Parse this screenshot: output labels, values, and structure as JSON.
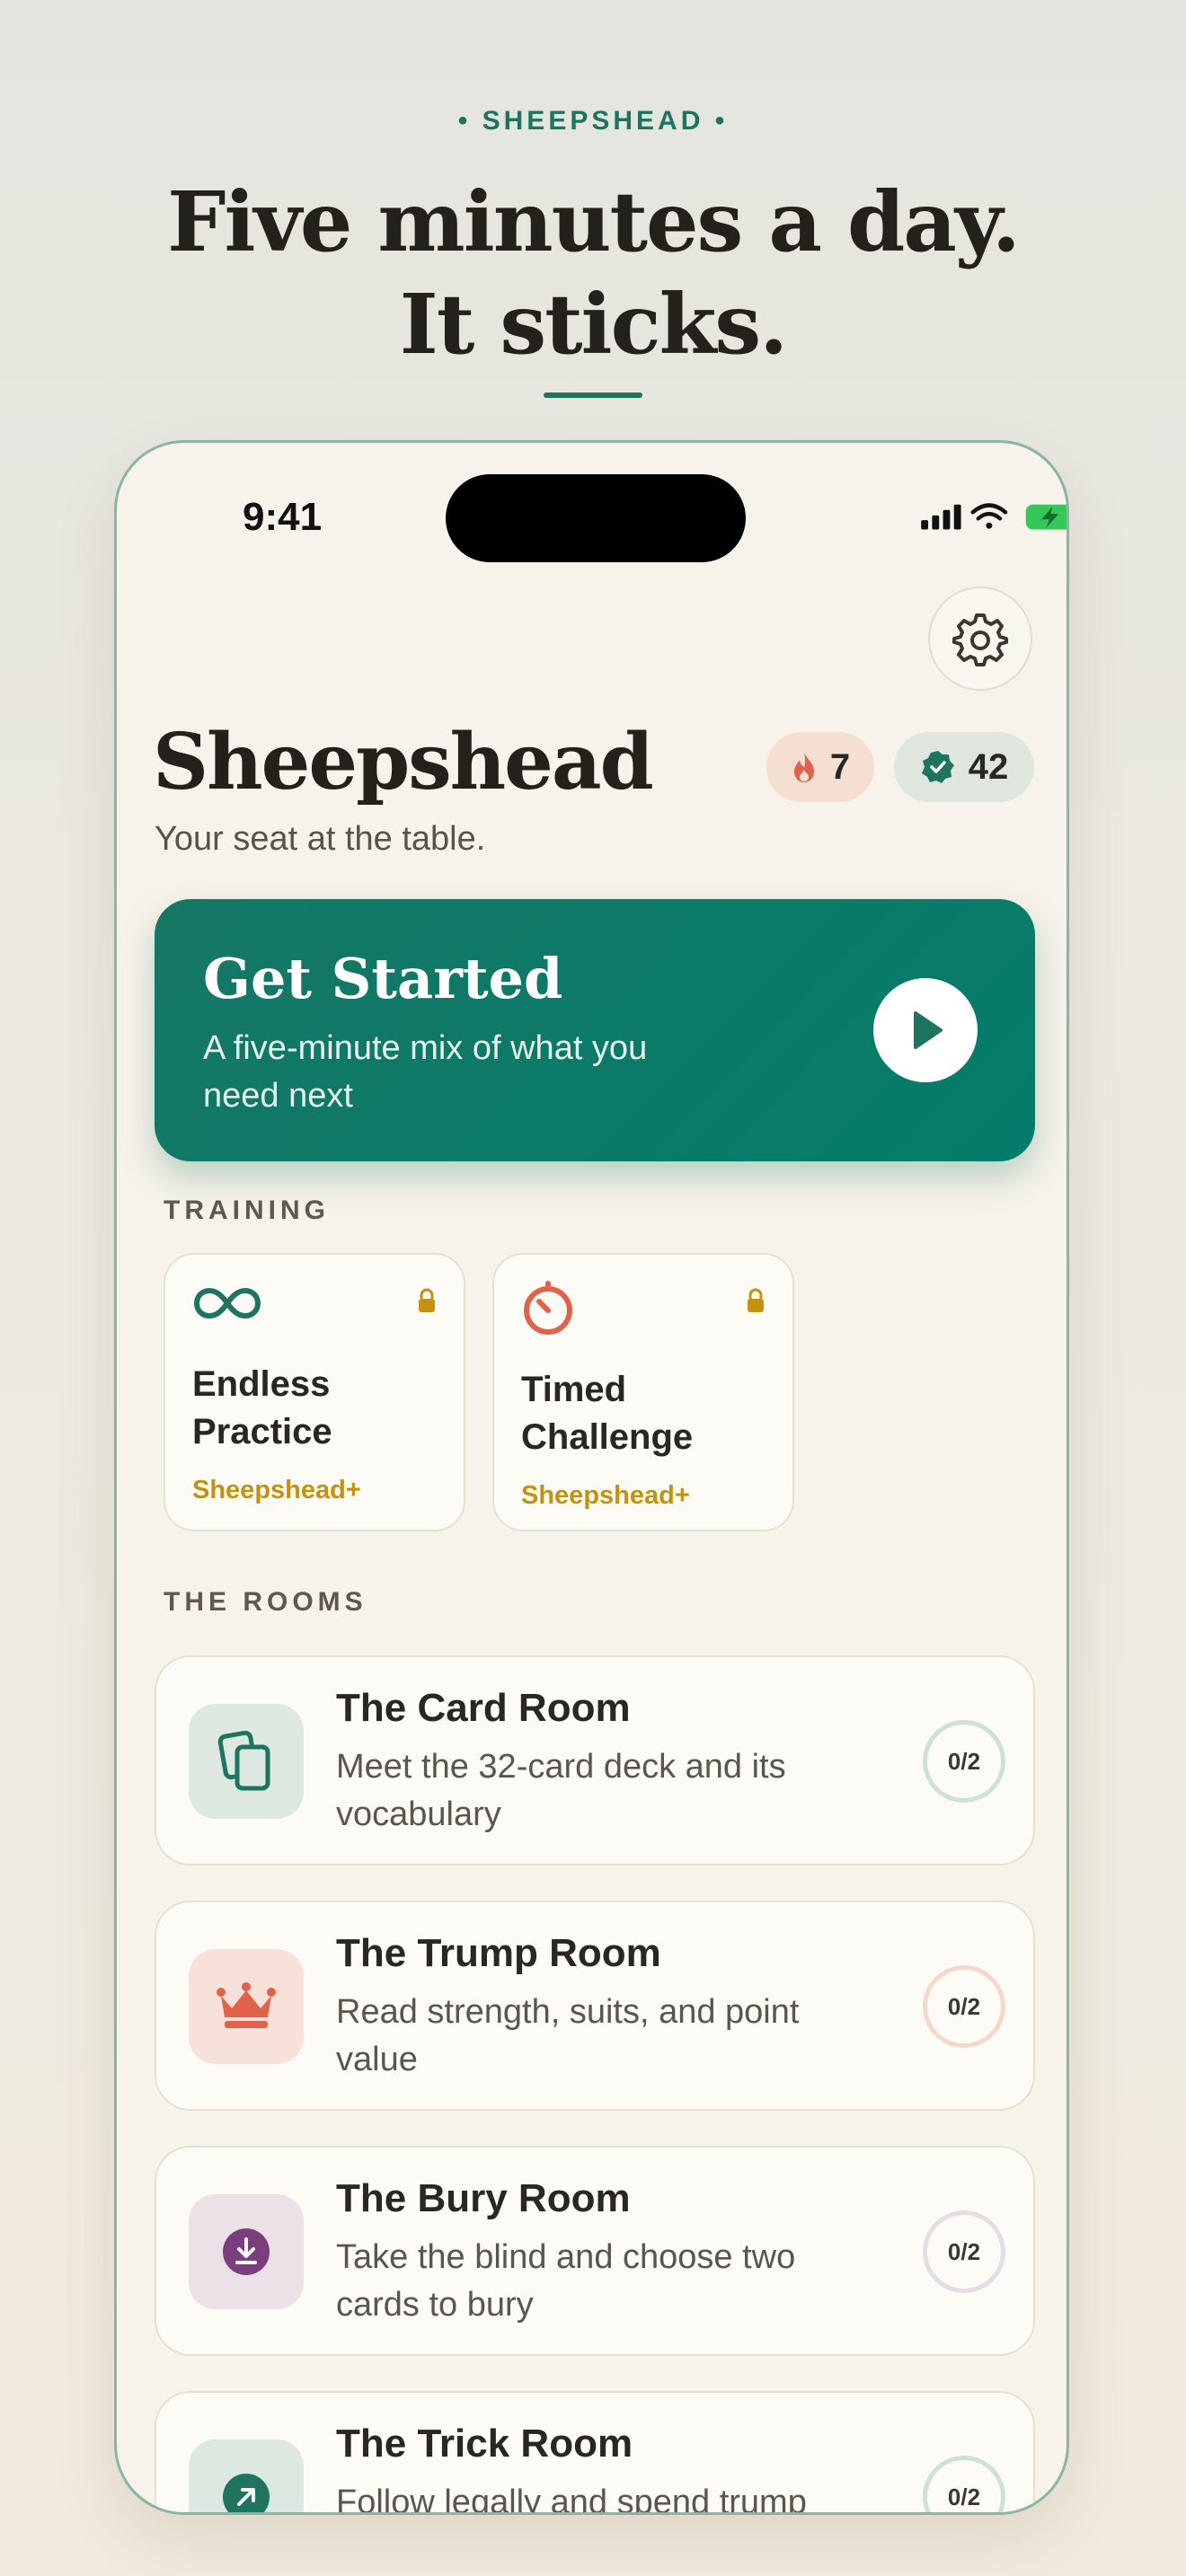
{
  "marketing": {
    "eyebrow": "• SHEEPSHEAD •",
    "headline": "Five minutes a day. It sticks."
  },
  "status_bar": {
    "time": "9:41"
  },
  "header": {
    "title": "Sheepshead",
    "subtitle": "Your seat at the table.",
    "streak_count": "7",
    "xp_count": "42"
  },
  "hero": {
    "title": "Get Started",
    "subtitle": "A five-minute mix of what you need next"
  },
  "training": {
    "label": "TRAINING",
    "cards": [
      {
        "name": "Endless Practice",
        "tag": "Sheepshead+",
        "icon": "infinity-icon"
      },
      {
        "name": "Timed Challenge",
        "tag": "Sheepshead+",
        "icon": "timer-icon"
      }
    ]
  },
  "rooms": {
    "label": "THE ROOMS",
    "items": [
      {
        "title": "The Card Room",
        "desc": "Meet the 32-card deck and its vocabulary",
        "progress": "0/2",
        "icon": "cards-icon",
        "color": "#1f7460"
      },
      {
        "title": "The Trump Room",
        "desc": "Read strength, suits, and point value",
        "progress": "0/2",
        "icon": "crown-icon",
        "color": "#e0624a"
      },
      {
        "title": "The Bury Room",
        "desc": "Take the blind and choose two cards to bury",
        "progress": "0/2",
        "icon": "download-icon",
        "color": "#7a3e7d"
      },
      {
        "title": "The Trick Room",
        "desc": "Follow legally and spend trump",
        "progress": "0/2",
        "icon": "arrow-up-right-icon",
        "color": "#1f7460"
      }
    ]
  },
  "colors": {
    "accent": "#1f7460",
    "hero_bg": "#047c6b",
    "premium": "#c4920e",
    "streak": "#e0624a"
  }
}
